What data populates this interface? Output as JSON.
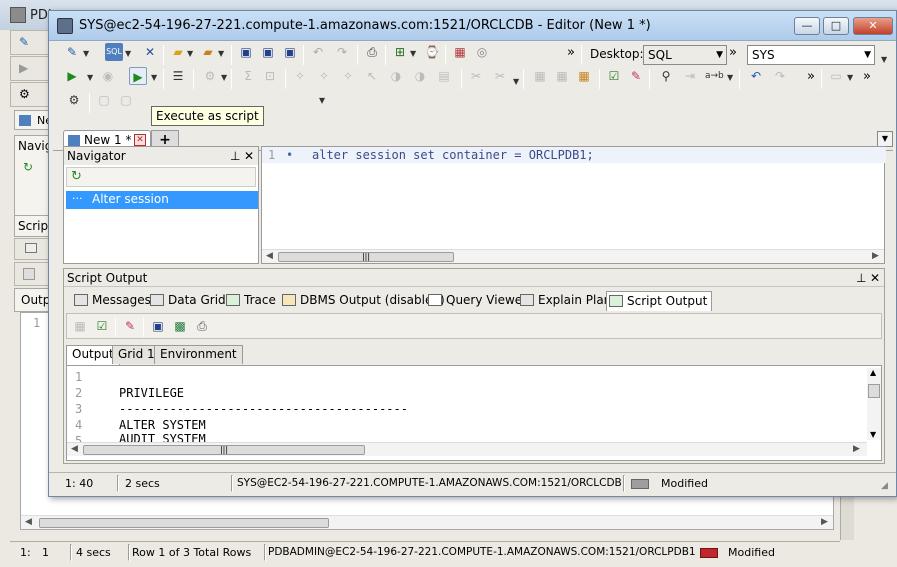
{
  "background_window": {
    "title": "PDI",
    "panel_labels": {
      "navigator": "Naviga",
      "script": "Script",
      "output": "Outpu",
      "new_tab": "Ne"
    },
    "gutter_line": "1",
    "status": {
      "line": "1:",
      "col": "1",
      "time": "4 secs",
      "rows": "Row 1 of 3 Total Rows",
      "connection": "PDBADMIN@EC2-54-196-27-221.COMPUTE-1.AMAZONAWS.COM:1521/ORCLPDB1",
      "state": "Modified"
    }
  },
  "window": {
    "title": "SYS@ec2-54-196-27-221.compute-1.amazonaws.com:1521/ORCLCDB - Editor (New 1 *)",
    "minimize": "—",
    "maximize": "□",
    "close": "✕"
  },
  "toolbar": {
    "desktop_label": "Desktop:",
    "desktop_value": "SQL",
    "connection_value": "SYS",
    "more": "»"
  },
  "tooltip": "Execute as script",
  "tabs": [
    {
      "label": "New 1 *"
    }
  ],
  "add_tab": "+",
  "navigator": {
    "title": "Navigator",
    "items": [
      {
        "label": "Alter session"
      }
    ]
  },
  "editor": {
    "lines": [
      {
        "number": "1",
        "marker": "•",
        "text": "alter session set container = ORCLPDB1;"
      }
    ]
  },
  "script_output": {
    "title": "Script Output",
    "tabs": [
      {
        "label": "Messages"
      },
      {
        "label": "Data Grid"
      },
      {
        "label": "Trace"
      },
      {
        "label": "DBMS Output (disabled)"
      },
      {
        "label": "Query Viewer"
      },
      {
        "label": "Explain Plan"
      },
      {
        "label": "Script Output"
      }
    ],
    "subtabs": [
      {
        "label": "Output"
      },
      {
        "label": "Grid 1"
      },
      {
        "label": "Environment"
      }
    ],
    "lines": [
      {
        "number": "1",
        "text": ""
      },
      {
        "number": "2",
        "text": "PRIVILEGE"
      },
      {
        "number": "3",
        "text": "----------------------------------------"
      },
      {
        "number": "4",
        "text": "ALTER SYSTEM"
      },
      {
        "number": "5",
        "text": "AUDIT SYSTEM"
      }
    ]
  },
  "status": {
    "position": "1: 40",
    "time": "2 secs",
    "connection": "SYS@EC2-54-196-27-221.COMPUTE-1.AMAZONAWS.COM:1521/ORCLCDB",
    "state": "Modified"
  },
  "colors": {
    "accent": "#3399ff",
    "title_bar": "#aecbea",
    "close_button": "#c2412a"
  }
}
